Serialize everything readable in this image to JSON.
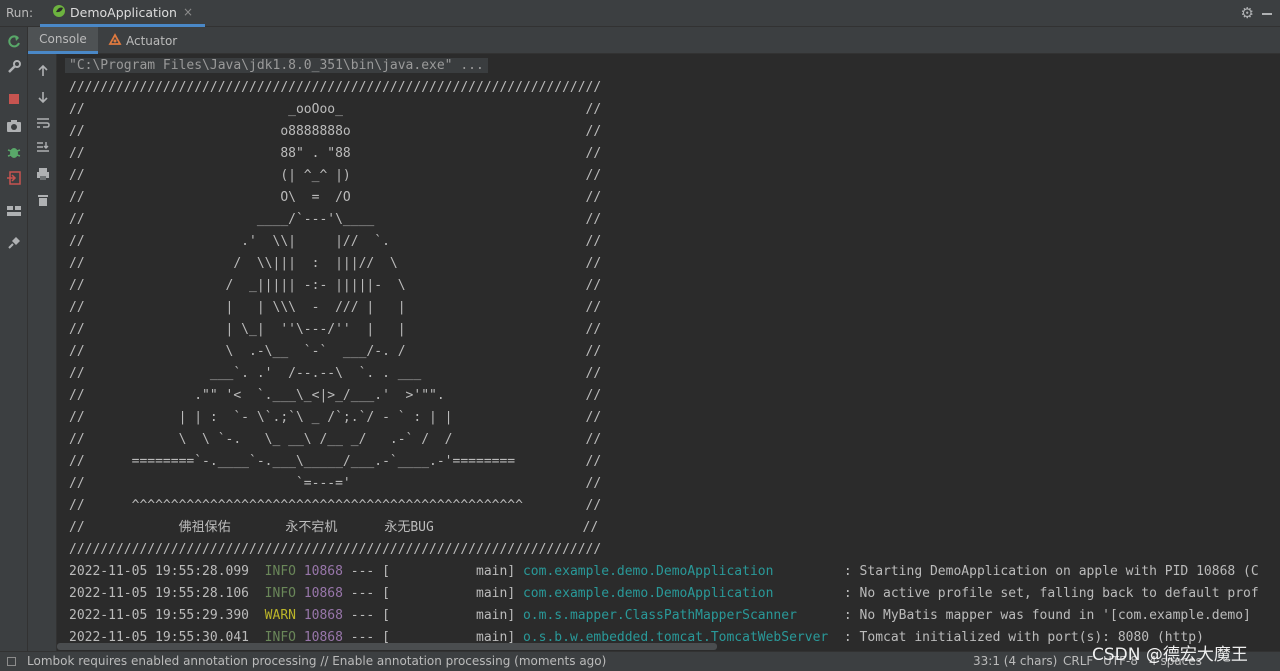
{
  "run": {
    "label": "Run:",
    "tab_title": "DemoApplication",
    "close_glyph": "×"
  },
  "subtabs": {
    "console": "Console",
    "actuator": "Actuator"
  },
  "console": {
    "command": "\"C:\\Program Files\\Java\\jdk1.8.0_351\\bin\\java.exe\" ...",
    "banner": [
      "////////////////////////////////////////////////////////////////////",
      "//                          _ooOoo_                               //",
      "//                         o8888888o                              //",
      "//                         88\" . \"88                              //",
      "//                         (| ^_^ |)                              //",
      "//                         O\\  =  /O                              //",
      "//                      ____/`---'\\____                           //",
      "//                    .'  \\\\|     |//  `.                         //",
      "//                   /  \\\\|||  :  |||//  \\                        //",
      "//                  /  _||||| -:- |||||-  \\                       //",
      "//                  |   | \\\\\\  -  /// |   |                       //",
      "//                  | \\_|  ''\\---/''  |   |                       //",
      "//                  \\  .-\\__  `-`  ___/-. /                       //",
      "//                ___`. .'  /--.--\\  `. . ___                     //",
      "//              .\"\" '<  `.___\\_<|>_/___.'  >'\"\".                  //",
      "//            | | :  `- \\`.;`\\ _ /`;.`/ - ` : | |                 //",
      "//            \\  \\ `-.   \\_ __\\ /__ _/   .-` /  /                 //",
      "//      ========`-.____`-.___\\_____/___.-`____.-'========         //",
      "//                           `=---='                              //",
      "//      ^^^^^^^^^^^^^^^^^^^^^^^^^^^^^^^^^^^^^^^^^^^^^^^^^^        //",
      "//            佛祖保佑       永不宕机      永无BUG                   //",
      "////////////////////////////////////////////////////////////////////"
    ],
    "logs": [
      {
        "time": "2022-11-05 19:55:28.099",
        "level": "INFO",
        "pid": "10868",
        "sep": " --- [",
        "thread": "           main]",
        "logger": " com.example.demo.DemoApplication        ",
        "msg": " : Starting DemoApplication on apple with PID 10868 (C"
      },
      {
        "time": "2022-11-05 19:55:28.106",
        "level": "INFO",
        "pid": "10868",
        "sep": " --- [",
        "thread": "           main]",
        "logger": " com.example.demo.DemoApplication        ",
        "msg": " : No active profile set, falling back to default prof"
      },
      {
        "time": "2022-11-05 19:55:29.390",
        "level": "WARN",
        "pid": "10868",
        "sep": " --- [",
        "thread": "           main]",
        "logger": " o.m.s.mapper.ClassPathMapperScanner     ",
        "msg": " : No MyBatis mapper was found in '[com.example.demo]"
      },
      {
        "time": "2022-11-05 19:55:30.041",
        "level": "INFO",
        "pid": "10868",
        "sep": " --- [",
        "thread": "           main]",
        "logger": " o.s.b.w.embedded.tomcat.TomcatWebServer ",
        "msg": " : Tomcat initialized with port(s): 8080 (http)"
      }
    ]
  },
  "status": {
    "message": "Lombok requires enabled annotation processing // Enable annotation processing (moments ago)",
    "position": "33:1 (4 chars)",
    "line_sep": "CRLF",
    "encoding": "UTF-8",
    "indent": "4 spaces"
  },
  "watermark": "CSDN @德宏大魔王",
  "colors": {
    "accent": "#4a88c7",
    "info": "#6a8759",
    "warn": "#bbb529",
    "logger": "#299999",
    "pid": "#9876aa"
  },
  "icons": {
    "left": [
      "rerun-icon",
      "wrench-icon",
      "stop-icon",
      "camera-icon",
      "debug-bug-icon",
      "exit-icon",
      "layout-icon",
      "pin-icon"
    ],
    "tool": [
      "scroll-up-icon",
      "scroll-down-icon",
      "soft-wrap-icon",
      "scroll-to-end-icon",
      "print-icon",
      "trash-icon"
    ]
  }
}
